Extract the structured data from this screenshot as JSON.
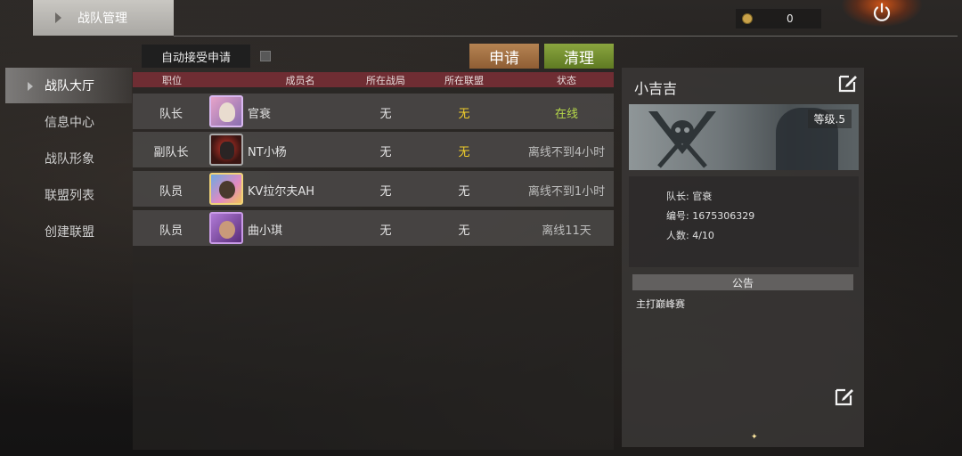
{
  "header": {
    "title": "战队管理",
    "currency_value": "0"
  },
  "sidebar": {
    "items": [
      {
        "label": "战队大厅",
        "active": true
      },
      {
        "label": "信息中心"
      },
      {
        "label": "战队形象"
      },
      {
        "label": "联盟列表"
      },
      {
        "label": "创建联盟"
      }
    ]
  },
  "toolbar": {
    "auto_accept_label": "自动接受申请",
    "auto_accept_checked": false,
    "apply_label": "申请",
    "clear_label": "清理"
  },
  "table": {
    "headers": [
      "职位",
      "成员名",
      "所在战局",
      "所在联盟",
      "状态"
    ],
    "rows": [
      {
        "position": "队长",
        "name": "官衰",
        "battle": "无",
        "alliance": "无",
        "status": "在线",
        "alliance_color": "#f2cf2b",
        "status_color": "#b6d84a"
      },
      {
        "position": "副队长",
        "name": "NT小杨",
        "battle": "无",
        "alliance": "无",
        "status": "离线不到4小时",
        "alliance_color": "#f2cf2b",
        "status_color": "#bdbdbd"
      },
      {
        "position": "队员",
        "name": "KV拉尔夫AH",
        "battle": "无",
        "alliance": "无",
        "status": "离线不到1小时",
        "alliance_color": "#e5e5e5",
        "status_color": "#bdbdbd"
      },
      {
        "position": "队员",
        "name": "曲小琪",
        "battle": "无",
        "alliance": "无",
        "status": "离线11天",
        "alliance_color": "#e5e5e5",
        "status_color": "#bdbdbd"
      }
    ]
  },
  "team": {
    "name": "小吉吉",
    "level": "等级.5",
    "leader_line": "队长:  官衰",
    "id_line": "编号:  1675306329",
    "count_line": "人数:  4/10",
    "notice_title": "公告",
    "notice_text": "主打巅峰赛"
  },
  "colors": {
    "accent_header": "#6f2d33",
    "apply_button": "#b58352",
    "clear_button": "#8aa53f",
    "online": "#b6d84a",
    "highlight": "#f2cf2b"
  }
}
